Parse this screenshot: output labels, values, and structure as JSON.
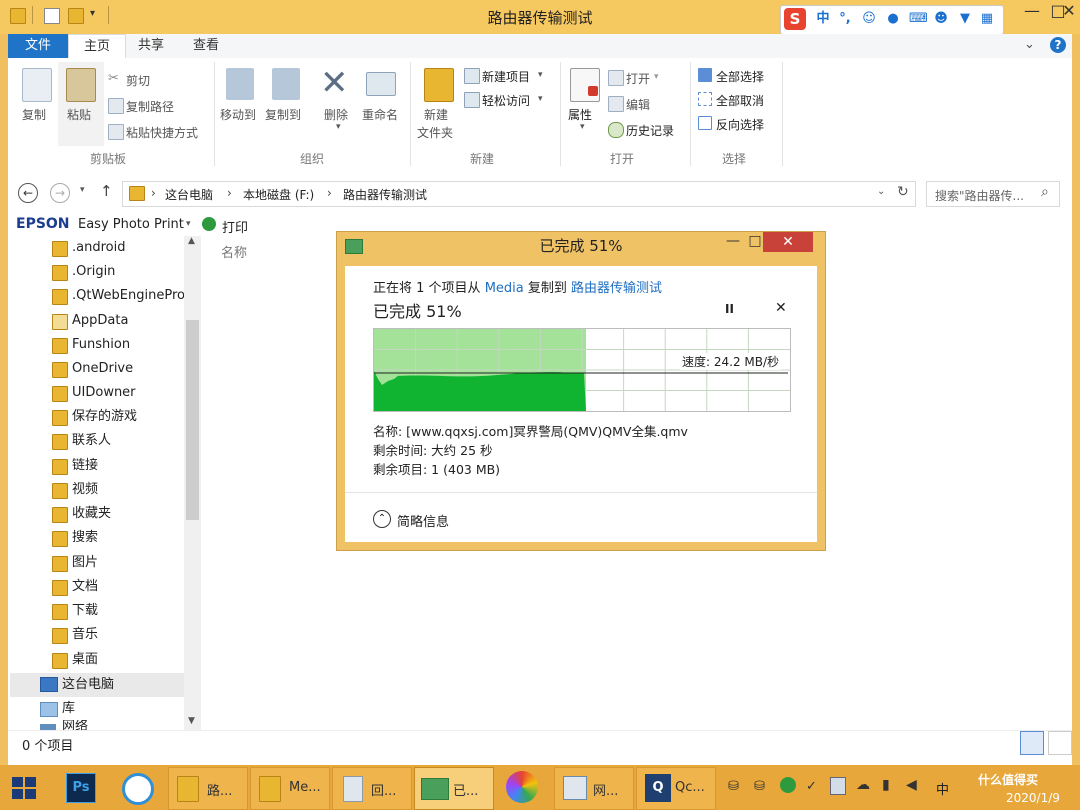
{
  "window": {
    "title": "路由器传输测试",
    "controls": {
      "minimize": "—",
      "restore": "□",
      "close": "✕"
    }
  },
  "ime": {
    "logo": "S",
    "mode": "中",
    "punct": "°,"
  },
  "ribbon": {
    "tabs": [
      "文件",
      "主页",
      "共享",
      "查看"
    ],
    "clipboard": {
      "copy": "复制",
      "paste": "粘贴",
      "cut": "剪切",
      "copy_path": "复制路径",
      "paste_shortcut": "粘贴快捷方式",
      "group": "剪贴板"
    },
    "organize": {
      "move_to": "移动到",
      "copy_to": "复制到",
      "delete": "删除",
      "rename": "重命名",
      "group": "组织"
    },
    "new": {
      "new_folder_line1": "新建",
      "new_folder_line2": "文件夹",
      "new_item": "新建项目",
      "easy_access": "轻松访问",
      "group": "新建"
    },
    "open": {
      "properties": "属性",
      "open": "打开",
      "edit": "编辑",
      "history": "历史记录",
      "group": "打开"
    },
    "select": {
      "select_all": "全部选择",
      "select_none": "全部取消",
      "invert": "反向选择",
      "group": "选择"
    },
    "help": "?"
  },
  "address": {
    "crumbs": [
      "这台电脑",
      "本地磁盘 (F:)",
      "路由器传输测试"
    ],
    "search_placeholder": "搜索\"路由器传...",
    "sep": "›"
  },
  "epson": {
    "brand": "EPSON",
    "app": "Easy Photo Print",
    "print": "打印"
  },
  "nav": {
    "items": [
      ".android",
      ".Origin",
      ".QtWebEngineProcess",
      "AppData",
      "Funshion",
      "OneDrive",
      "UIDowner",
      "保存的游戏",
      "联系人",
      "链接",
      "视频",
      "收藏夹",
      "搜索",
      "图片",
      "文档",
      "下载",
      "音乐",
      "桌面",
      "这台电脑",
      "库",
      "网络"
    ]
  },
  "main": {
    "column_name": "名称"
  },
  "status": {
    "count": "0 个项目"
  },
  "dialog": {
    "title": "已完成 51%",
    "line1_prefix": "正在将 1 个项目从",
    "source": "Media",
    "line1_mid": "复制到",
    "dest": "路由器传输测试",
    "progress_text": "已完成 51%",
    "progress": 0.51,
    "speed": "速度: 24.2 MB/秒",
    "name": "名称: [www.qqxsj.com]冥界警局(QMV)QMV全集.qmv",
    "time_left": "剩余时间: 大约 25 秒",
    "items_left": "剩余项目: 1 (403 MB)",
    "less_details": "简略信息",
    "pause": "II",
    "close": "✕"
  },
  "taskbar": {
    "items": [
      {
        "label": "路...",
        "icon": "folder-icon"
      },
      {
        "label": "Me...",
        "icon": "folder-icon"
      },
      {
        "label": "回...",
        "icon": "recycle-bin-icon"
      },
      {
        "label": "已...",
        "icon": "copy-progress-icon"
      },
      {
        "label": "网...",
        "icon": "network-icon"
      },
      {
        "label": "Qc...",
        "icon": "qc-icon"
      }
    ],
    "watermark": "什么值得买",
    "date": "2020/1/9",
    "ime": "中"
  },
  "colors": {
    "accent": "#1f74c8",
    "frame": "#f0c060",
    "progress": "#10b431",
    "taskbar": "#e8a73a",
    "close": "#c8423a"
  }
}
